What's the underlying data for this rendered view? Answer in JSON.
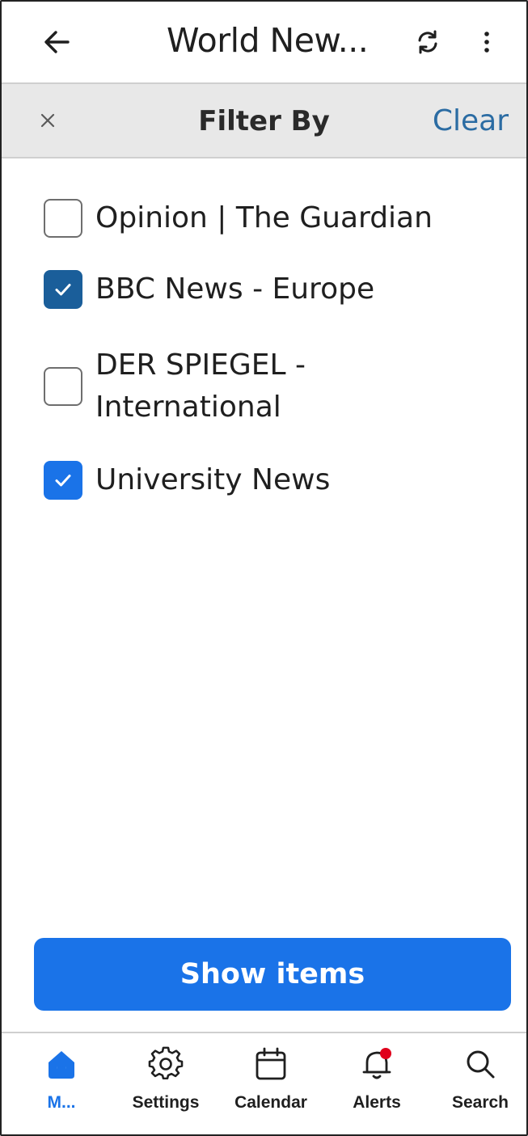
{
  "appbar": {
    "title": "World New...",
    "icons": [
      "arrow-left-icon",
      "refresh-icon",
      "more-vertical-icon"
    ]
  },
  "filter": {
    "close_label": "×",
    "title": "Filter By",
    "clear_label": "Clear"
  },
  "options": [
    {
      "label": "Opinion | The Guardian",
      "checked": false
    },
    {
      "label": "BBC News - Europe",
      "checked": true,
      "check_color": "#1a5e9a"
    },
    {
      "label": "DER SPIEGEL - International",
      "checked": false
    },
    {
      "label": "University News",
      "checked": true,
      "check_color": "#1a73e8"
    }
  ],
  "show_button": {
    "label": "Show items"
  },
  "bottom_nav": [
    {
      "label": "M...",
      "icon": "home-icon",
      "active": true
    },
    {
      "label": "Settings",
      "icon": "gear-icon",
      "active": false
    },
    {
      "label": "Calendar",
      "icon": "calendar-icon",
      "active": false
    },
    {
      "label": "Alerts",
      "icon": "bell-icon",
      "active": false,
      "badge": true
    },
    {
      "label": "Search",
      "icon": "search-icon",
      "active": false
    }
  ],
  "colors": {
    "accent": "#1a73e8",
    "clear_link": "#2b6ca3",
    "badge": "#e0001b"
  }
}
